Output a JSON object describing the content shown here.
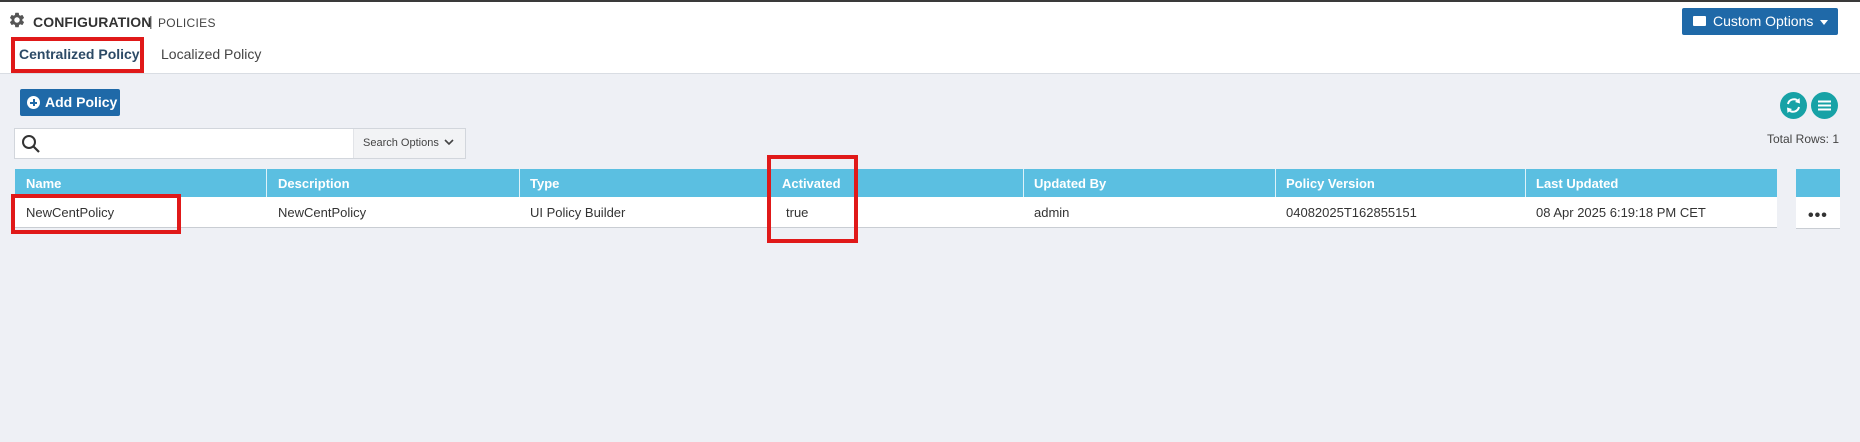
{
  "header": {
    "title": "CONFIGURATION",
    "separator": "|",
    "subtitle": "POLICIES",
    "icon": "gear-icon",
    "custom_options_label": "Custom Options"
  },
  "tabs": [
    {
      "label": "Centralized Policy",
      "active": true
    },
    {
      "label": "Localized Policy",
      "active": false
    }
  ],
  "toolbar": {
    "add_policy_label": "Add Policy",
    "refresh_icon": "refresh-icon",
    "menu_icon": "menu-icon"
  },
  "search": {
    "value": "",
    "placeholder": "",
    "options_label": "Search Options"
  },
  "table": {
    "total_rows_label": "Total Rows: 1",
    "columns": [
      "Name",
      "Description",
      "Type",
      "Activated",
      "Updated By",
      "Policy Version",
      "Last Updated"
    ],
    "rows": [
      {
        "name": "NewCentPolicy",
        "description": "NewCentPolicy",
        "type": "UI Policy Builder",
        "activated": "true",
        "updated_by": "admin",
        "policy_version": "04082025T162855151",
        "last_updated": "08 Apr 2025 6:19:18 PM CET",
        "actions": "•••"
      }
    ]
  },
  "colors": {
    "primary_button": "#1f69a8",
    "table_header": "#5bbfe1",
    "round_button": "#17a2a6",
    "highlight_box": "#e01919",
    "background": "#eef0f5"
  }
}
